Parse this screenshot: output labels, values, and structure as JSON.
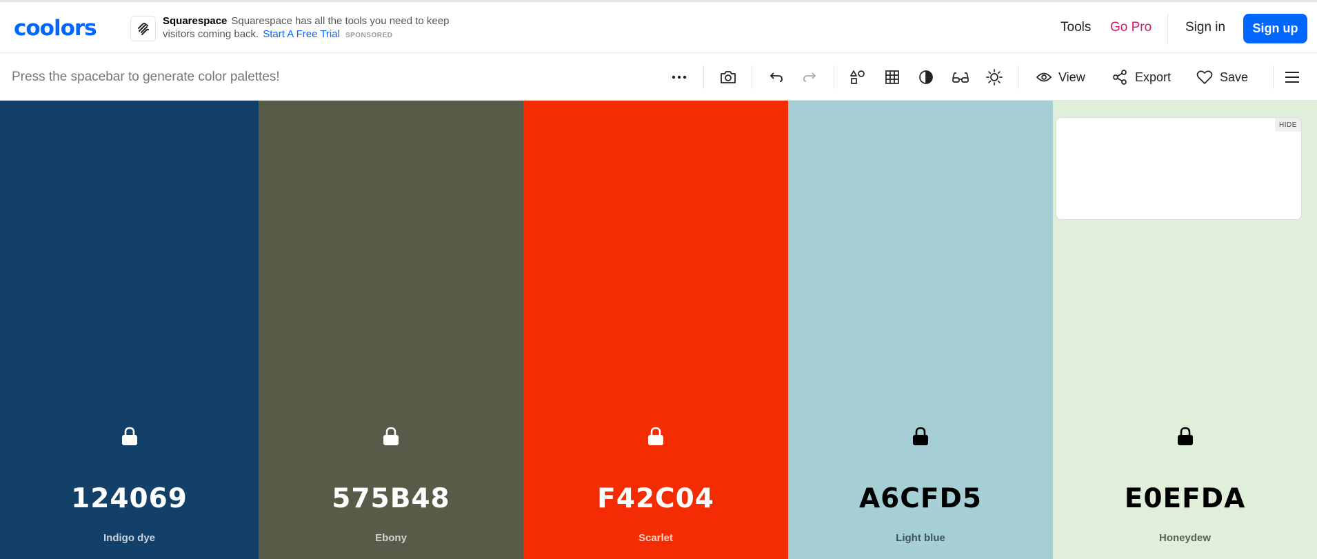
{
  "app": {
    "logo": "coolors"
  },
  "ad": {
    "brand": "Squarespace",
    "text": "Squarespace has all the tools you need to keep visitors coming back.",
    "cta": "Start A Free Trial",
    "sponsored": "SPONSORED"
  },
  "nav": {
    "tools": "Tools",
    "go_pro": "Go Pro",
    "sign_in": "Sign in",
    "sign_up": "Sign up"
  },
  "toolbar": {
    "hint": "Press the spacebar to generate color palettes!",
    "view": "View",
    "export": "Export",
    "save": "Save",
    "icons": [
      "more-icon",
      "camera-icon",
      "undo-icon",
      "redo-icon",
      "shapes-icon",
      "grid-icon",
      "contrast-icon",
      "glasses-icon",
      "brightness-icon",
      "eye-icon",
      "share-icon",
      "heart-icon",
      "menu-icon"
    ]
  },
  "palette": [
    {
      "hex": "124069",
      "name": "Indigo dye",
      "color": "#124069",
      "text_color": "#ffffff",
      "name_color": "#c9d3de",
      "locked": false
    },
    {
      "hex": "575B48",
      "name": "Ebony",
      "color": "#575B48",
      "text_color": "#ffffff",
      "name_color": "#d2d3cc",
      "locked": false
    },
    {
      "hex": "F42C04",
      "name": "Scarlet",
      "color": "#F42C04",
      "text_color": "#ffffff",
      "name_color": "#fcd2c8",
      "locked": false
    },
    {
      "hex": "A6CFD5",
      "name": "Light blue",
      "color": "#A6CFD5",
      "text_color": "#000000",
      "name_color": "#3f5457",
      "locked": false
    },
    {
      "hex": "E0EFDA",
      "name": "Honeydew",
      "color": "#E0EFDA",
      "text_color": "#000000",
      "name_color": "#5a6157",
      "locked": false
    }
  ],
  "ad_card": {
    "hide_label": "HIDE"
  }
}
